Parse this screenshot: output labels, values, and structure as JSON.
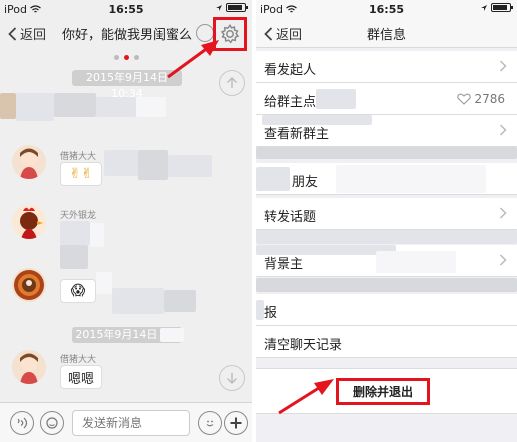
{
  "left_screen": {
    "status": {
      "carrier": "iPod",
      "time": "16:55"
    },
    "nav": {
      "back_label": "返回",
      "title": "你好，能做我男闺蜜么"
    },
    "timestamps": [
      "2015年9月14日 10:34",
      "2015年9月14日 10:"
    ],
    "messages": [
      {
        "sender": "借猪大大",
        "text": "✌✌"
      },
      {
        "sender": "天外银龙",
        "text": ""
      },
      {
        "sender": "",
        "text": "😱"
      },
      {
        "sender": "借猪大大",
        "text": "嗯嗯"
      }
    ],
    "input": {
      "placeholder": "发送新消息"
    }
  },
  "right_screen": {
    "status": {
      "carrier": "iPod",
      "time": "16:55"
    },
    "nav": {
      "back_label": "返回",
      "title": "群信息"
    },
    "menu": [
      {
        "label": "看发起人"
      },
      {
        "label": "给群主点",
        "count": "2786"
      },
      {
        "label": "查看新群主"
      },
      {
        "label": "朋友"
      },
      {
        "label": "转发话题"
      },
      {
        "label": "背景主"
      },
      {
        "label": "报"
      },
      {
        "label": "清空聊天记录"
      }
    ],
    "exit_button": "删除并退出"
  },
  "colors": {
    "highlight": "#e3141d",
    "chat_bg": "#efefef",
    "settings_bg": "#efeff4"
  }
}
